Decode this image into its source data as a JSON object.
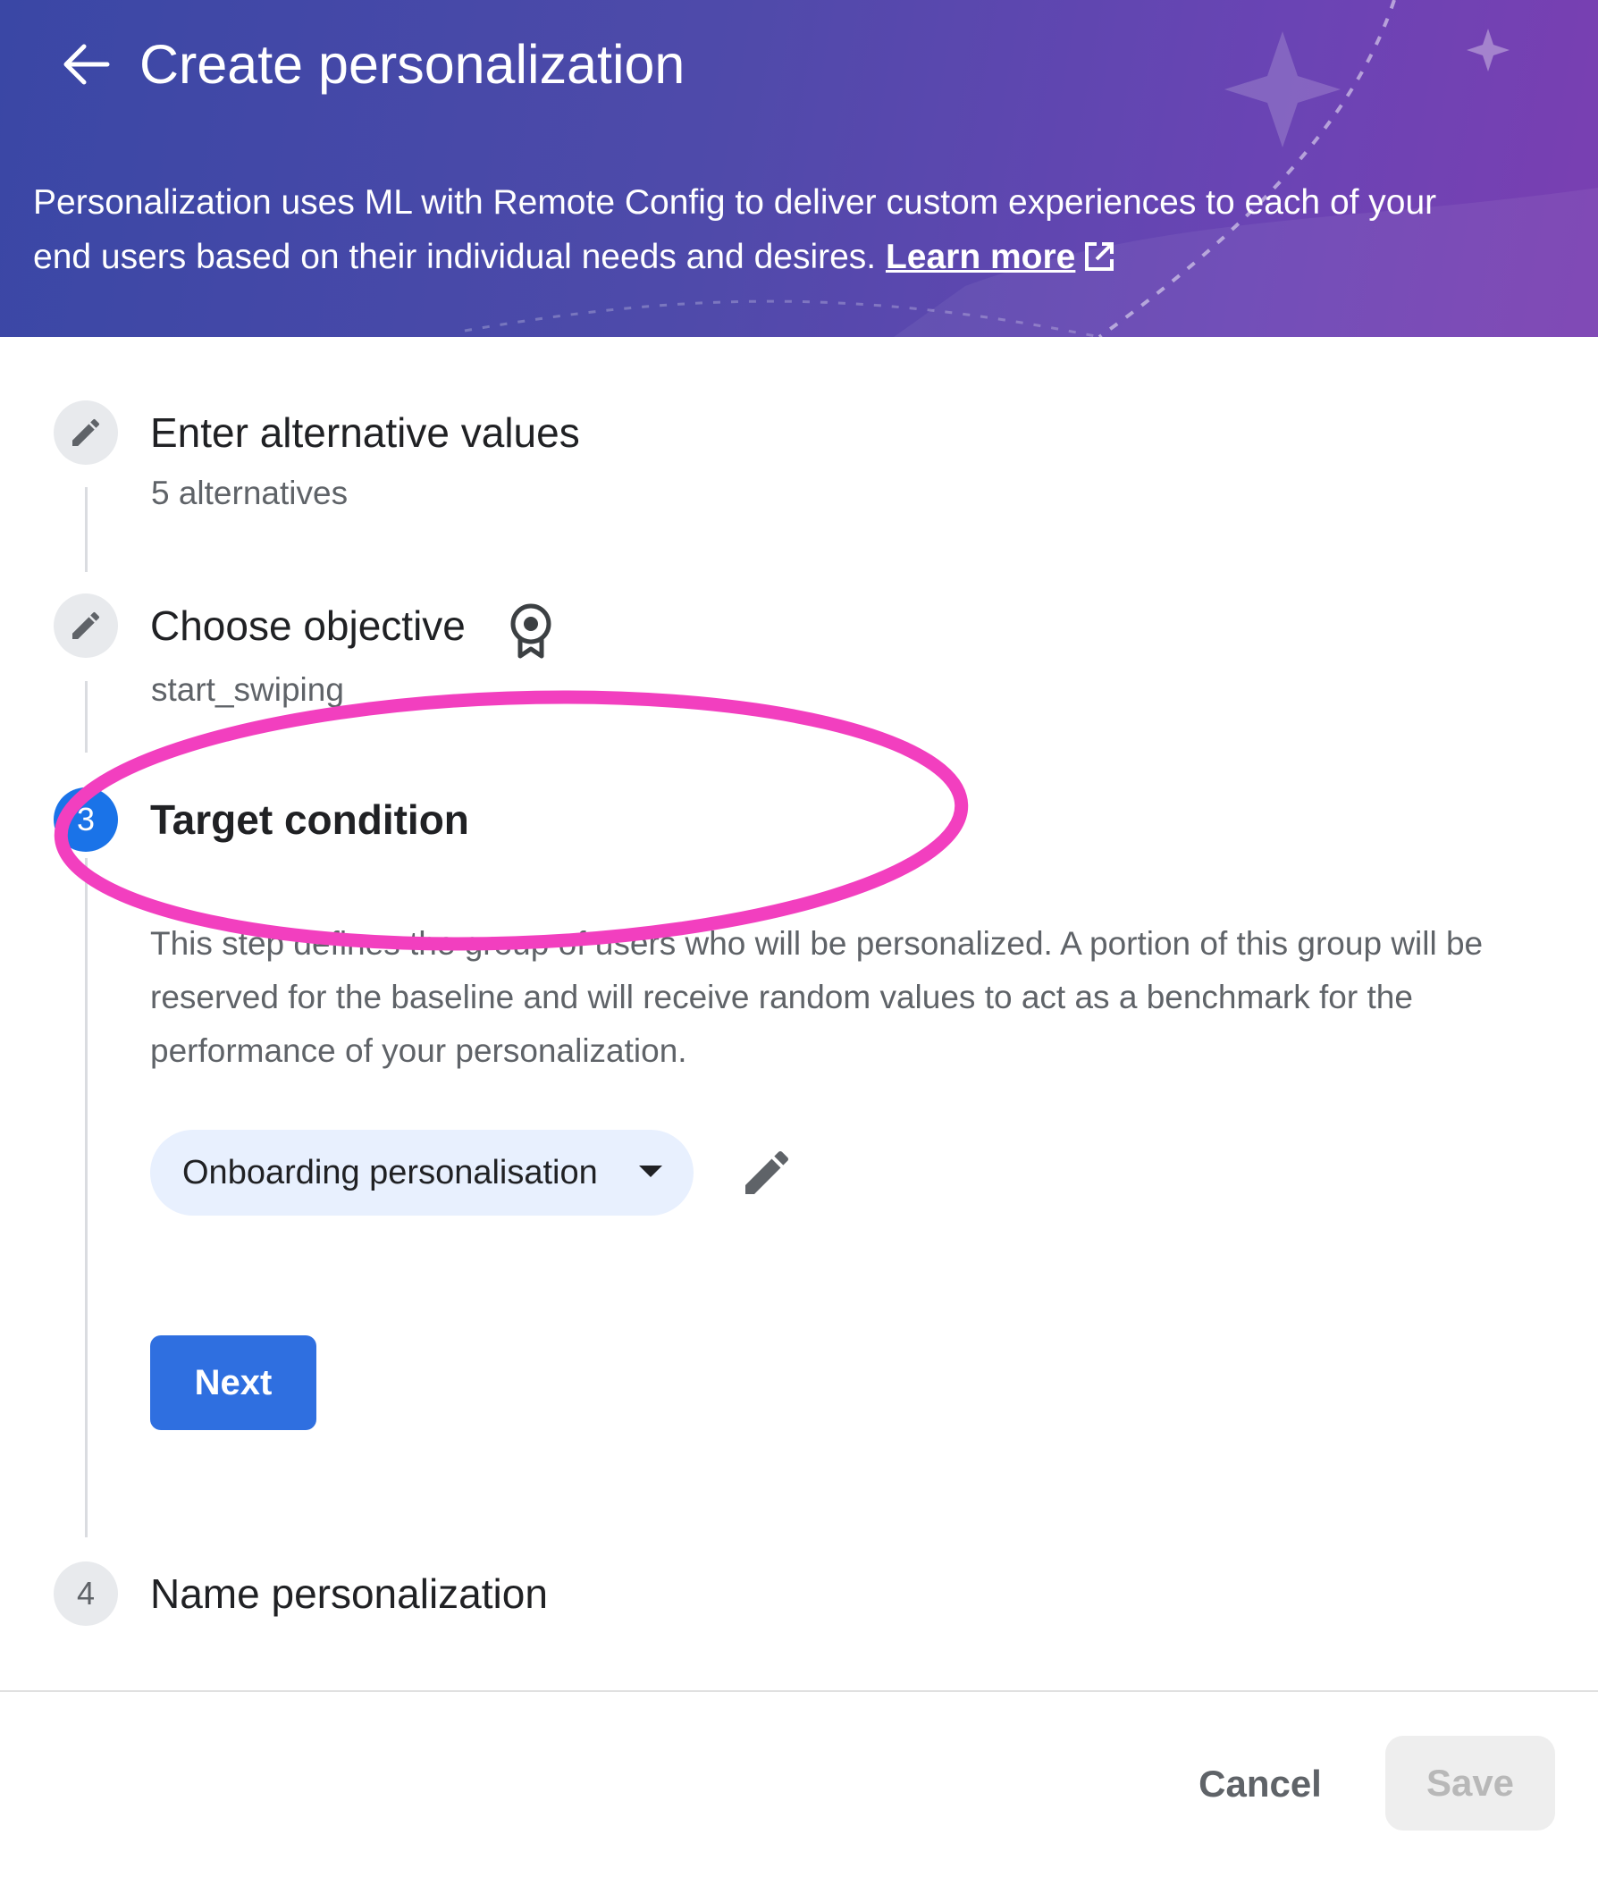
{
  "header": {
    "title": "Create personalization",
    "intro_text": "Personalization uses ML with Remote Config to deliver custom experiences to each of your end users based on their individual needs and desires.",
    "learn_more_label": "Learn more"
  },
  "steps": [
    {
      "number": "",
      "icon": "pencil-icon",
      "title": "Enter alternative values",
      "summary": "5 alternatives",
      "state": "completed"
    },
    {
      "number": "",
      "icon": "pencil-icon",
      "title": "Choose objective",
      "summary": "start_swiping",
      "state": "completed",
      "badge_icon": "award-icon"
    },
    {
      "number": "3",
      "title": "Target condition",
      "state": "active",
      "description": "This step defines the group of users who will be personalized. A portion of this group will be reserved for the baseline and will receive random values to act as a benchmark for the performance of your personalization.",
      "condition_selected": "Onboarding personalisation",
      "next_label": "Next"
    },
    {
      "number": "4",
      "title": "Name personalization",
      "state": "pending"
    }
  ],
  "footer": {
    "cancel_label": "Cancel",
    "save_label": "Save"
  },
  "colors": {
    "accent": "#1a73e8",
    "highlight": "#f23fbf",
    "header_start": "#3a47a5",
    "header_end": "#7a3fb2"
  }
}
